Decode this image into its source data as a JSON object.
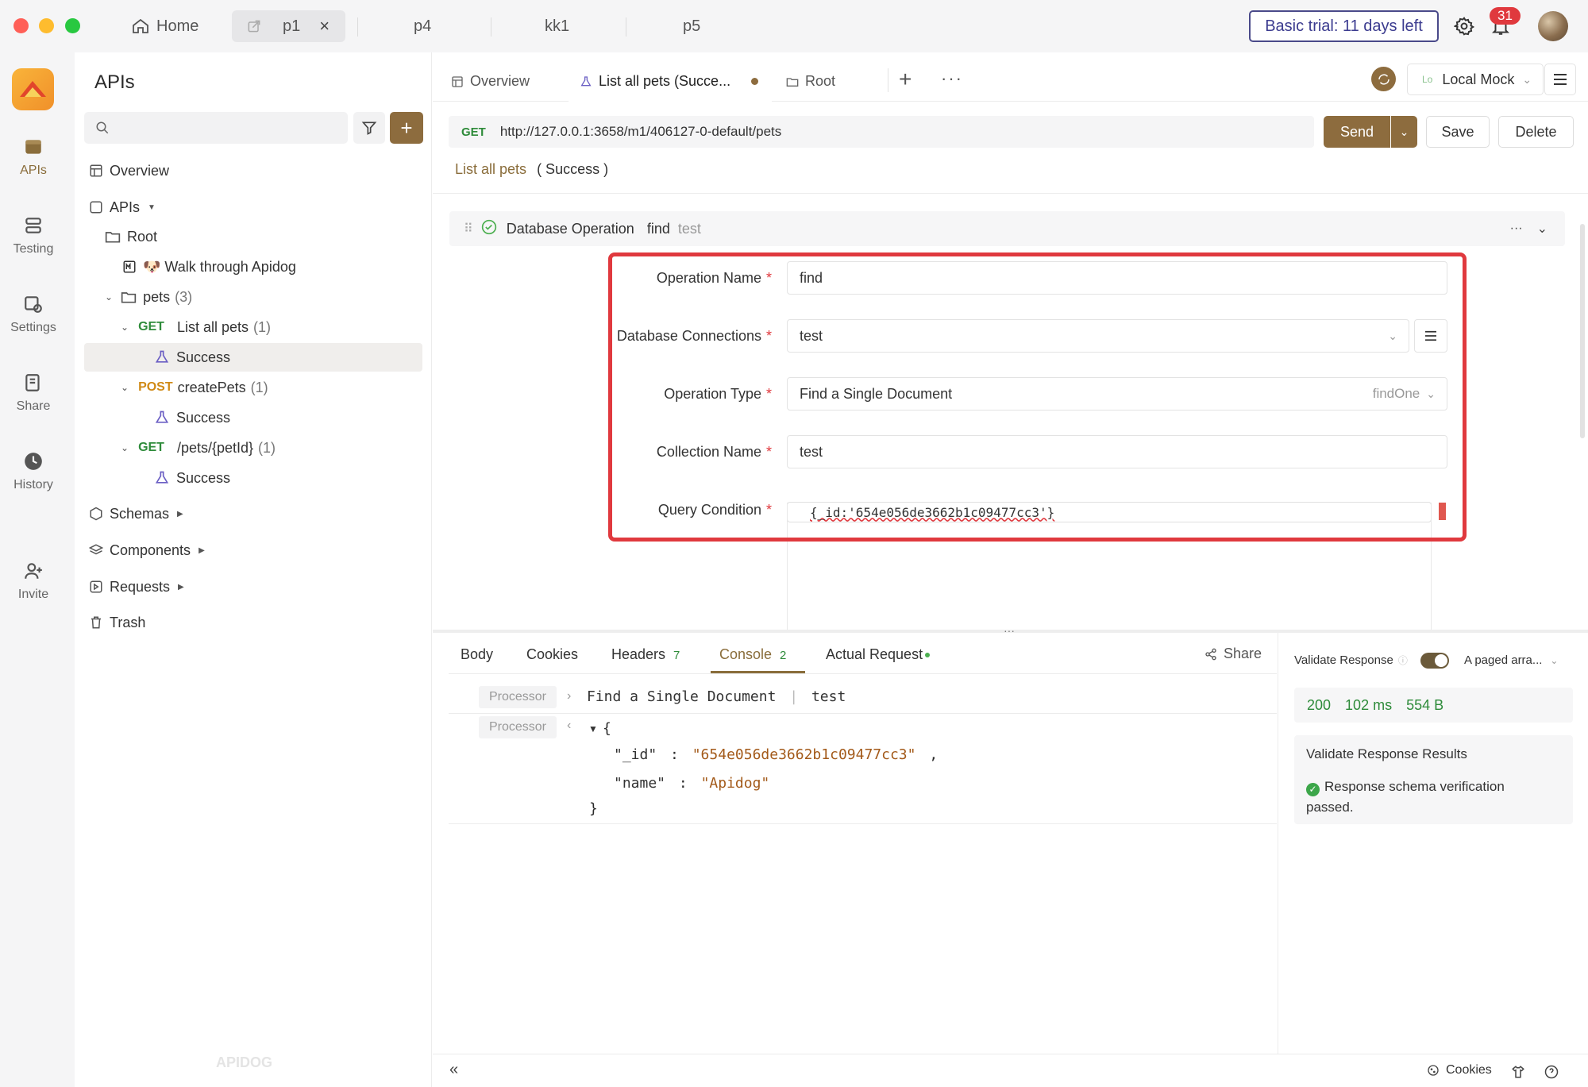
{
  "window_tabs": [
    {
      "label": "Home"
    },
    {
      "label": "p1"
    },
    {
      "label": "p4"
    },
    {
      "label": "kk1"
    },
    {
      "label": "p5"
    }
  ],
  "trial": "Basic trial: 11 days left",
  "notifications": "31",
  "rail": [
    {
      "label": "APIs"
    },
    {
      "label": "Testing"
    },
    {
      "label": "Settings"
    },
    {
      "label": "Share"
    },
    {
      "label": "History"
    },
    {
      "label": "Invite"
    }
  ],
  "sidebar": {
    "title": "APIs",
    "search_placeholder": "",
    "overview": "Overview",
    "apis": "APIs",
    "root": "Root",
    "walk": "🐶 Walk through Apidog",
    "pets": "pets",
    "pets_count": "(3)",
    "e1_method": "GET",
    "e1_name": "List all pets",
    "e1_count": "(1)",
    "e1_child": "Success",
    "e2_method": "POST",
    "e2_name": "createPets",
    "e2_count": "(1)",
    "e2_child": "Success",
    "e3_method": "GET",
    "e3_name": "/pets/{petId}",
    "e3_count": "(1)",
    "e3_child": "Success",
    "schemas": "Schemas",
    "components": "Components",
    "requests": "Requests",
    "trash": "Trash",
    "watermark": "APIDOG"
  },
  "page_tabs": [
    {
      "label": "Overview"
    },
    {
      "label": "List all pets (Succe..."
    },
    {
      "label": "Root"
    }
  ],
  "env": {
    "prefix": "Lo",
    "label": "Local Mock"
  },
  "request": {
    "method": "GET",
    "url": "http://127.0.0.1:3658/m1/406127-0-default/pets",
    "send": "Send",
    "save": "Save",
    "delete": "Delete"
  },
  "breadcrumb": {
    "link": "List all pets",
    "current": "( Success )"
  },
  "operation": {
    "title": "Database Operation",
    "name": "find",
    "connection": "test"
  },
  "form": {
    "op_name_label": "Operation Name",
    "op_name_value": "find",
    "db_conn_label": "Database Connections",
    "db_conn_value": "test",
    "op_type_label": "Operation Type",
    "op_type_value": "Find a Single Document",
    "op_type_hint": "findOne",
    "coll_label": "Collection Name",
    "coll_value": "test",
    "query_label": "Query Condition",
    "query_value": "{_id:'654e056de3662b1c09477cc3'}",
    "required_mark": "*"
  },
  "bottom_tabs": [
    {
      "label": "Body"
    },
    {
      "label": "Cookies"
    },
    {
      "label": "Headers",
      "count": "7"
    },
    {
      "label": "Console",
      "count": "2"
    },
    {
      "label": "Actual Request"
    }
  ],
  "share": "Share",
  "console": {
    "badge": "Processor",
    "line1_text": "Find a Single Document",
    "line1_sep": "|",
    "line1_target": "test",
    "open_brace": "{",
    "id_key": "\"_id\"",
    "id_val": "\"654e056de3662b1c09477cc3\"",
    "name_key": "\"name\"",
    "name_val": "\"Apidog\"",
    "colon": ":",
    "comma": ",",
    "close_brace": "}"
  },
  "response": {
    "validate_label": "Validate Response",
    "schema_label": "A paged arra...",
    "status": "200",
    "time": "102 ms",
    "size": "554 B",
    "results_title": "Validate Response Results",
    "results_text": "Response schema verification passed."
  },
  "footer": {
    "cookies": "Cookies"
  },
  "colors": {
    "accent": "#8d6c3e",
    "get": "#2e8b3a",
    "post": "#d08a16",
    "highlight": "#e0393e"
  }
}
